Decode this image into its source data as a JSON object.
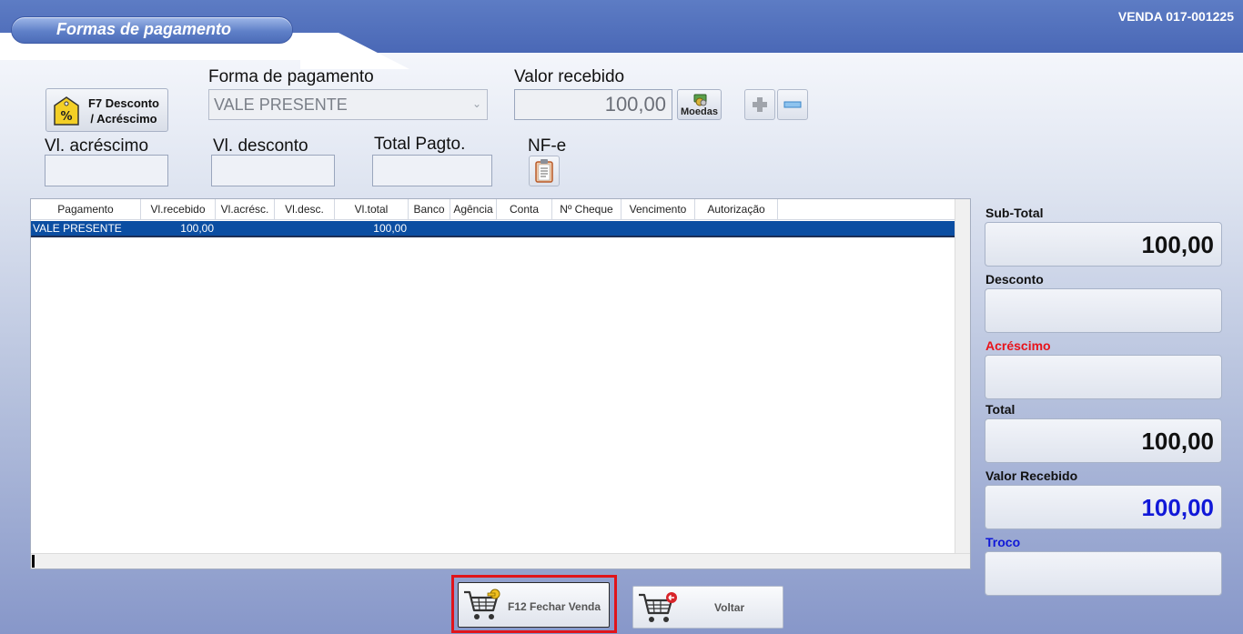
{
  "window": {
    "title": "Formas de pagamento",
    "venda": "VENDA 017-001225"
  },
  "toolbar": {
    "desconto_line1": "F7 Desconto",
    "desconto_line2": "/ Acréscimo",
    "forma_label": "Forma de pagamento",
    "forma_value": "VALE PRESENTE",
    "valor_label": "Valor recebido",
    "valor_value": "100,00",
    "moedas_label": "Moedas",
    "acrescimo_label": "Vl. acréscimo",
    "desconto_label": "Vl. desconto",
    "total_pagto_label": "Total Pagto.",
    "nfe_label": "NF-e"
  },
  "grid": {
    "columns": [
      "Pagamento",
      "Vl.recebido",
      "Vl.acrésc.",
      "Vl.desc.",
      "Vl.total",
      "Banco",
      "Agência",
      "Conta",
      "Nº Cheque",
      "Vencimento",
      "Autorização"
    ],
    "rows": [
      {
        "pagamento": "VALE PRESENTE",
        "vl_recebido": "100,00",
        "vl_acresc": "",
        "vl_desc": "",
        "vl_total": "100,00",
        "banco": "",
        "agencia": "",
        "conta": "",
        "cheque": "",
        "vencimento": "",
        "autorizacao": ""
      }
    ]
  },
  "summary": {
    "subtotal_label": "Sub-Total",
    "subtotal_value": "100,00",
    "desconto_label": "Desconto",
    "desconto_value": "",
    "acrescimo_label": "Acréscimo",
    "acrescimo_value": "",
    "total_label": "Total",
    "total_value": "100,00",
    "valor_recebido_label": "Valor Recebido",
    "valor_recebido_value": "100,00",
    "troco_label": "Troco",
    "troco_value": ""
  },
  "actions": {
    "fechar_label": "F12 Fechar Venda",
    "voltar_label": "Voltar"
  },
  "colors": {
    "header_blue": "#4a68b6",
    "selection_blue": "#0b4ea2",
    "acrescimo_red": "#e8141b",
    "troco_blue": "#1018d8",
    "highlight_red": "#e0141b"
  },
  "icons": [
    "percent-tag-icon",
    "coins-icon",
    "plus-icon",
    "minus-icon",
    "clipboard-icon",
    "cart-key-icon",
    "cart-back-icon"
  ]
}
